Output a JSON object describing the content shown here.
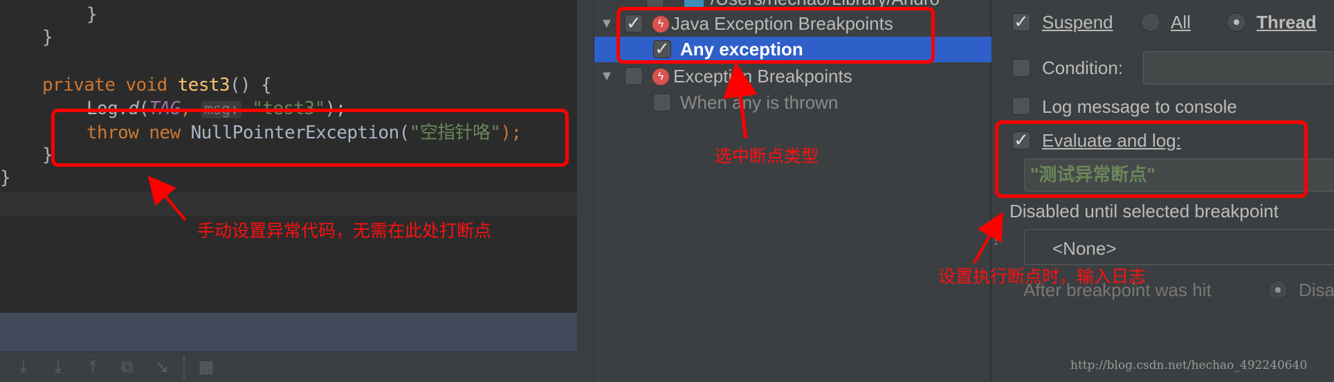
{
  "editor": {
    "lines": [
      {
        "indent": 2,
        "text": "}"
      },
      {
        "indent": 1,
        "text": "}"
      },
      {
        "indent": 1,
        "kw1": "private",
        "kw2": "void",
        "fn": "test3",
        "rest": "() {"
      },
      {
        "indent": 2,
        "pre": "Log.",
        "fn": "d",
        "open": "(",
        "const": "TAG",
        "comma": ", ",
        "hint": "msg:",
        "str": "\"test3\"",
        "close": ");"
      },
      {
        "indent": 2,
        "kw1": "throw",
        "kw2": "new",
        "cls": "NullPointerException(",
        "str": "\"空指针咯\"",
        "close": ");"
      },
      {
        "indent": 1,
        "text": "}"
      },
      {
        "indent": 0,
        "text": "}"
      }
    ],
    "toolbar_icons": [
      "step-over-icon",
      "step-into-icon",
      "step-out-icon",
      "drop-frame-icon",
      "run-to-cursor-icon",
      "evaluate-expression-icon"
    ]
  },
  "tree": {
    "top_path": "/Users/hechao/Library/Andro",
    "java_group": "Java Exception Breakpoints",
    "java_item": "Any exception",
    "exc_group": "Exception Breakpoints",
    "exc_item": "When any is thrown"
  },
  "settings": {
    "suspend": "Suspend",
    "suspend_checked": true,
    "all": "All",
    "thread": "Thread",
    "suspend_policy": "Thread",
    "condition": "Condition:",
    "condition_checked": false,
    "condition_value": "",
    "log_message": "Log message to console",
    "log_message_checked": false,
    "evaluate": "Evaluate and log:",
    "evaluate_checked": true,
    "evaluate_value": "\"测试异常断点\"",
    "disabled_until": "Disabled until selected breakpoint",
    "disabled_until_value": "<None>",
    "after_hit": "After breakpoint was hit",
    "after_hit_option": "Disa"
  },
  "annotations": {
    "code": "手动设置异常代码，无需在此处打断点",
    "tree": "选中断点类型",
    "settings": "设置执行断点时，输入日志",
    "color": "#ff0000"
  },
  "watermark": "http://blog.csdn.net/hechao_492240640"
}
